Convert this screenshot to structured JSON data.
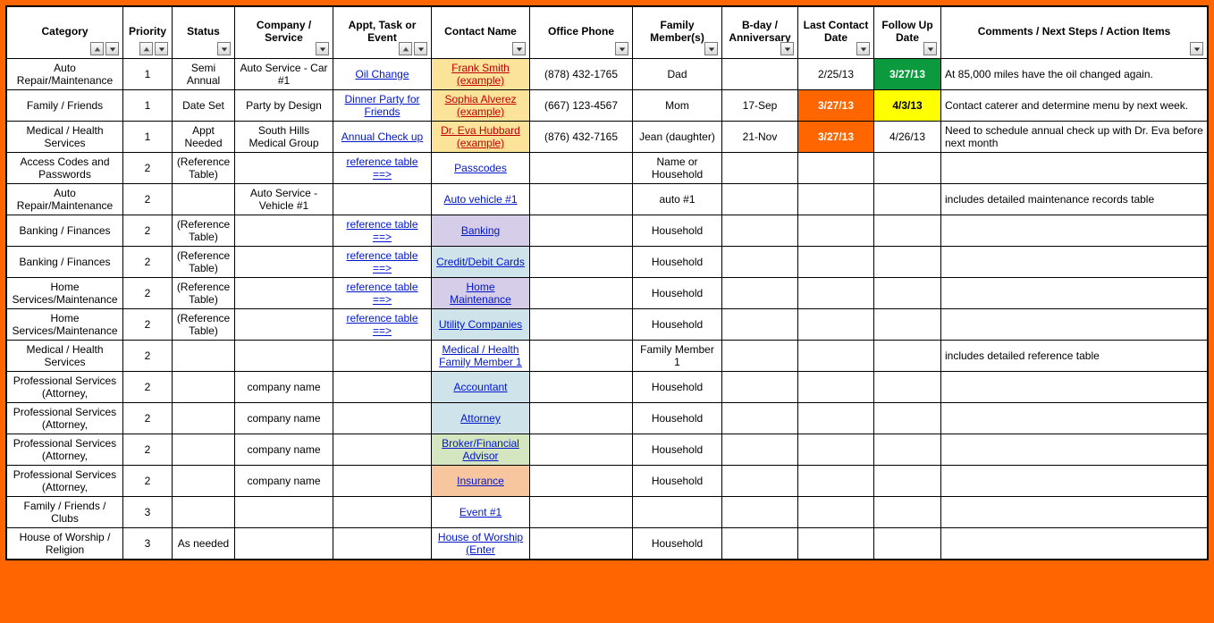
{
  "headers": [
    {
      "label": "Category",
      "sort": true,
      "filter": true
    },
    {
      "label": "Priority",
      "sort": true,
      "filter": true
    },
    {
      "label": "Status",
      "sort": false,
      "filter": true
    },
    {
      "label": "Company / Service",
      "sort": false,
      "filter": true
    },
    {
      "label": "Appt, Task or Event",
      "sort": true,
      "filter": true
    },
    {
      "label": "Contact Name",
      "sort": false,
      "filter": true
    },
    {
      "label": "Office Phone",
      "sort": false,
      "filter": true
    },
    {
      "label": "Family Member(s)",
      "sort": false,
      "filter": true
    },
    {
      "label": "B-day / Anniversary",
      "sort": false,
      "filter": true
    },
    {
      "label": "Last Contact Date",
      "sort": false,
      "filter": true
    },
    {
      "label": "Follow Up Date",
      "sort": false,
      "filter": true
    },
    {
      "label": "Comments / Next Steps / Action Items",
      "sort": false,
      "filter": true
    }
  ],
  "rows": [
    {
      "category": "Auto Repair/Maintenance",
      "priority": "1",
      "status": "Semi Annual",
      "company": "Auto Service - Car #1",
      "appt": "Oil Change",
      "apptLink": true,
      "contact": "Frank Smith (example)",
      "contactBg": "bg-yellowcell",
      "contactLinkRed": true,
      "phone": "(878) 432-1765",
      "family": "Dad",
      "bday": "",
      "lastContact": "2/25/13",
      "lcBg": "",
      "followUp": "3/27/13",
      "fuBg": "bg-fugreen",
      "comments": "At 85,000 miles have the oil changed again."
    },
    {
      "category": "Family / Friends",
      "priority": "1",
      "status": "Date Set",
      "company": "Party by Design",
      "appt": "Dinner Party for Friends",
      "apptLink": true,
      "contact": "Sophia Alverez (example)",
      "contactBg": "bg-yellowcell",
      "contactLinkRed": true,
      "phone": "(667) 123-4567",
      "family": "Mom",
      "bday": "17-Sep",
      "lastContact": "3/27/13",
      "lcBg": "bg-lcorange",
      "followUp": "4/3/13",
      "fuBg": "bg-fuyellow",
      "comments": "Contact caterer and determine menu by next week."
    },
    {
      "category": "Medical / Health Services",
      "priority": "1",
      "status": "Appt Needed",
      "company": "South Hills Medical Group",
      "appt": "Annual Check up",
      "apptLink": true,
      "contact": "Dr. Eva Hubbard (example)",
      "contactBg": "bg-yellowcell",
      "contactLinkRed": true,
      "phone": "(876) 432-7165",
      "family": "Jean (daughter)",
      "bday": "21-Nov",
      "lastContact": "3/27/13",
      "lcBg": "bg-lcorange",
      "followUp": "4/26/13",
      "fuBg": "",
      "comments": "Need to schedule annual check up with Dr. Eva before next month"
    },
    {
      "category": "Access Codes and Passwords",
      "priority": "2",
      "status": "(Reference Table)",
      "company": "",
      "appt": "reference table ==>",
      "apptLink": true,
      "contact": "Passcodes ",
      "contactBg": "",
      "contactLinkRed": false,
      "phone": "",
      "family": "Name or Household",
      "bday": "",
      "lastContact": "",
      "lcBg": "",
      "followUp": "",
      "fuBg": "",
      "comments": ""
    },
    {
      "category": "Auto Repair/Maintenance",
      "priority": "2",
      "status": "",
      "company": "Auto Service - Vehicle #1",
      "appt": "",
      "apptLink": false,
      "contact": "Auto vehicle #1",
      "contactBg": "",
      "contactLinkRed": false,
      "phone": "",
      "family": "auto #1",
      "bday": "",
      "lastContact": "",
      "lcBg": "",
      "followUp": "",
      "fuBg": "",
      "comments": "includes detailed maintenance records table"
    },
    {
      "category": "Banking / Finances",
      "priority": "2",
      "status": "(Reference Table)",
      "company": "",
      "appt": "reference table ==>",
      "apptLink": true,
      "contact": "Banking ",
      "contactBg": "bg-lav",
      "contactLinkRed": false,
      "phone": "",
      "family": "Household",
      "bday": "",
      "lastContact": "",
      "lcBg": "",
      "followUp": "",
      "fuBg": "",
      "comments": ""
    },
    {
      "category": "Banking / Finances",
      "priority": "2",
      "status": "(Reference Table)",
      "company": "",
      "appt": "reference table ==>",
      "apptLink": true,
      "contact": "Credit/Debit Cards ",
      "contactBg": "bg-blue",
      "contactLinkRed": false,
      "phone": "",
      "family": "Household",
      "bday": "",
      "lastContact": "",
      "lcBg": "",
      "followUp": "",
      "fuBg": "",
      "comments": ""
    },
    {
      "category": "Home Services/Maintenance",
      "priority": "2",
      "status": "(Reference Table)",
      "company": "",
      "appt": "reference table ==>",
      "apptLink": true,
      "contact": "Home Maintenance ",
      "contactBg": "bg-lav",
      "contactLinkRed": false,
      "phone": "",
      "family": "Household",
      "bday": "",
      "lastContact": "",
      "lcBg": "",
      "followUp": "",
      "fuBg": "",
      "comments": ""
    },
    {
      "category": "Home Services/Maintenance",
      "priority": "2",
      "status": "(Reference Table)",
      "company": "",
      "appt": "reference table ==>",
      "apptLink": true,
      "contact": "Utility Companies",
      "contactBg": "bg-blue",
      "contactLinkRed": false,
      "phone": "",
      "family": "Household",
      "bday": "",
      "lastContact": "",
      "lcBg": "",
      "followUp": "",
      "fuBg": "",
      "comments": ""
    },
    {
      "category": "Medical / Health Services",
      "priority": "2",
      "status": "",
      "company": "",
      "appt": "",
      "apptLink": false,
      "contact": "Medical / Health Family Member 1",
      "contactBg": "",
      "contactLinkRed": false,
      "phone": "",
      "family": "Family Member 1",
      "bday": "",
      "lastContact": "",
      "lcBg": "",
      "followUp": "",
      "fuBg": "",
      "comments": "includes detailed reference table"
    },
    {
      "category": "Professional Services (Attorney,",
      "priority": "2",
      "status": "",
      "company": "company name",
      "appt": "",
      "apptLink": false,
      "contact": "Accountant ",
      "contactBg": "bg-blue",
      "contactLinkRed": false,
      "phone": "",
      "family": "Household",
      "bday": "",
      "lastContact": "",
      "lcBg": "",
      "followUp": "",
      "fuBg": "",
      "comments": ""
    },
    {
      "category": "Professional Services (Attorney,",
      "priority": "2",
      "status": "",
      "company": "company name",
      "appt": "",
      "apptLink": false,
      "contact": "Attorney ",
      "contactBg": "bg-blue",
      "contactLinkRed": false,
      "phone": "",
      "family": "Household",
      "bday": "",
      "lastContact": "",
      "lcBg": "",
      "followUp": "",
      "fuBg": "",
      "comments": ""
    },
    {
      "category": "Professional Services (Attorney,",
      "priority": "2",
      "status": "",
      "company": "company name",
      "appt": "",
      "apptLink": false,
      "contact": "Broker/Financial Advisor ",
      "contactBg": "bg-green2",
      "contactLinkRed": false,
      "phone": "",
      "family": "Household",
      "bday": "",
      "lastContact": "",
      "lcBg": "",
      "followUp": "",
      "fuBg": "",
      "comments": ""
    },
    {
      "category": "Professional Services (Attorney,",
      "priority": "2",
      "status": "",
      "company": "company name",
      "appt": "",
      "apptLink": false,
      "contact": "Insurance ",
      "contactBg": "bg-orange2",
      "contactLinkRed": false,
      "phone": "",
      "family": "Household",
      "bday": "",
      "lastContact": "",
      "lcBg": "",
      "followUp": "",
      "fuBg": "",
      "comments": ""
    },
    {
      "category": "Family / Friends / Clubs",
      "priority": "3",
      "status": "",
      "company": "",
      "appt": "",
      "apptLink": false,
      "contact": "Event #1 ",
      "contactBg": "",
      "contactLinkRed": false,
      "phone": "",
      "family": "",
      "bday": "",
      "lastContact": "",
      "lcBg": "",
      "followUp": "",
      "fuBg": "",
      "comments": ""
    },
    {
      "category": "House of Worship / Religion",
      "priority": "3",
      "status": "As needed",
      "company": "",
      "appt": "",
      "apptLink": false,
      "contact": "House of Worship (Enter ",
      "contactBg": "",
      "contactLinkRed": false,
      "phone": "",
      "family": "Household",
      "bday": "",
      "lastContact": "",
      "lcBg": "",
      "followUp": "",
      "fuBg": "",
      "comments": ""
    }
  ]
}
